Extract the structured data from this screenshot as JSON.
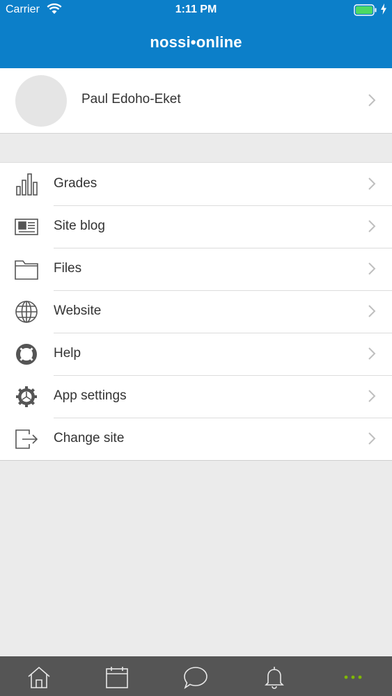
{
  "status_bar": {
    "carrier": "Carrier",
    "time": "1:11 PM",
    "battery_color": "#4cd964"
  },
  "header": {
    "title": "nossi•online",
    "background": "#0c7fc9"
  },
  "profile": {
    "name": "Paul Edoho-Eket"
  },
  "menu": {
    "items": [
      {
        "label": "Grades",
        "icon": "bar-chart-icon"
      },
      {
        "label": "Site blog",
        "icon": "newspaper-icon"
      },
      {
        "label": "Files",
        "icon": "folder-icon"
      },
      {
        "label": "Website",
        "icon": "globe-icon"
      },
      {
        "label": "Help",
        "icon": "lifebuoy-icon"
      },
      {
        "label": "App settings",
        "icon": "gear-icon"
      },
      {
        "label": "Change site",
        "icon": "exit-icon"
      }
    ]
  },
  "tab_bar": {
    "tabs": [
      {
        "icon": "home-icon"
      },
      {
        "icon": "calendar-icon"
      },
      {
        "icon": "chat-icon"
      },
      {
        "icon": "bell-icon"
      },
      {
        "icon": "more-icon",
        "active": true
      }
    ],
    "active_color": "#7fb800"
  }
}
